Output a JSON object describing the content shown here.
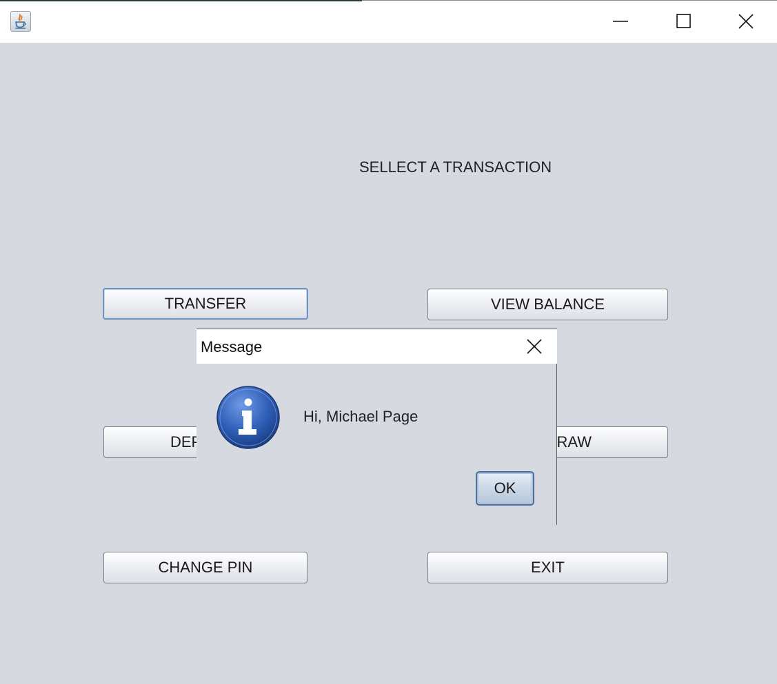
{
  "window": {
    "controls": {
      "minimize_icon": "minimize-icon",
      "maximize_icon": "maximize-icon",
      "close_icon": "close-icon"
    }
  },
  "main": {
    "heading": "SELLECT A TRANSACTION",
    "buttons": {
      "transfer": "TRANSFER",
      "view_balance": "VIEW BALANCE",
      "deposit_visible": "DEP",
      "withdraw_visible": "RAW",
      "change_pin": "CHANGE PIN",
      "exit": "EXIT"
    }
  },
  "dialog": {
    "title": "Message",
    "icon": "info-icon",
    "message": "Hi, Michael Page",
    "ok_label": "OK"
  },
  "colors": {
    "background": "#d6d9e0",
    "titlebar": "#ffffff",
    "focus_border": "#6f94c2",
    "info_icon_blue": "#2f5fb8"
  }
}
